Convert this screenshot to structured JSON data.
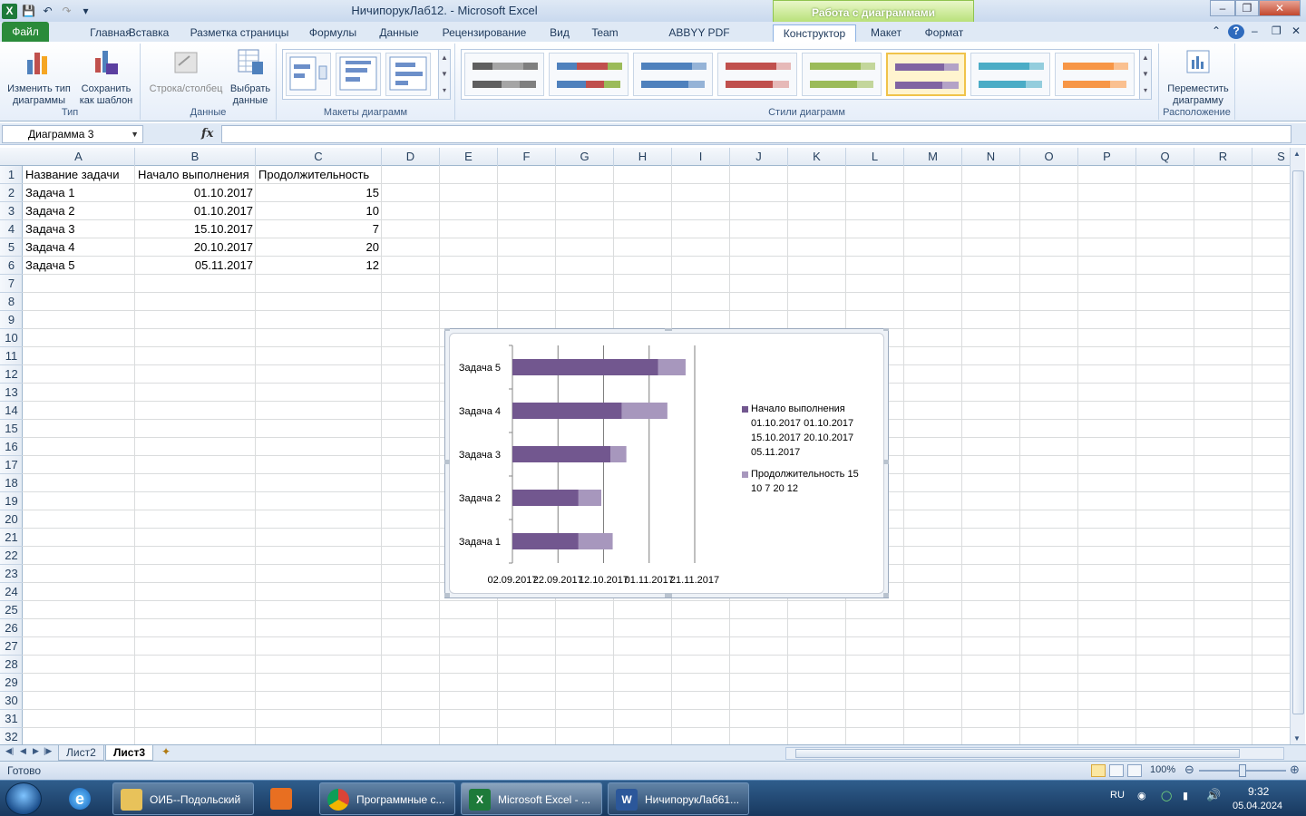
{
  "window": {
    "title": "НичипорукЛаб12.  -  Microsoft Excel",
    "context_tab_group": "Работа с диаграммами"
  },
  "tabs": {
    "file": "Файл",
    "items": [
      "Главная",
      "Вставка",
      "Разметка страницы",
      "Формулы",
      "Данные",
      "Рецензирование",
      "Вид",
      "Team",
      "ABBYY PDF Transformer+",
      "Конструктор",
      "Макет",
      "Формат"
    ],
    "active": "Конструктор"
  },
  "ribbon": {
    "group_type": {
      "label": "Тип",
      "change_type_1": "Изменить тип",
      "change_type_2": "диаграммы",
      "save_template_1": "Сохранить",
      "save_template_2": "как шаблон"
    },
    "group_data": {
      "label": "Данные",
      "row_col": "Строка/столбец",
      "select_data_1": "Выбрать",
      "select_data_2": "данные"
    },
    "group_layouts": {
      "label": "Макеты диаграмм"
    },
    "group_styles": {
      "label": "Стили диаграмм",
      "palettes": [
        [
          "#5f5f5f",
          "#a5a5a5",
          "#7f7f7f"
        ],
        [
          "#4f81bd",
          "#c0504d",
          "#9bbb59"
        ],
        [
          "#4f81bd",
          "#4f81bd",
          "#95b3d7"
        ],
        [
          "#c0504d",
          "#c0504d",
          "#e6b9b8"
        ],
        [
          "#9bbb59",
          "#9bbb59",
          "#c3d69b"
        ],
        [
          "#8064a2",
          "#8064a2",
          "#b3a2c7"
        ],
        [
          "#4bacc6",
          "#4bacc6",
          "#93cddd"
        ],
        [
          "#f79646",
          "#f79646",
          "#fac090"
        ]
      ],
      "selected_index": 5
    },
    "group_location": {
      "label": "Расположение",
      "move_1": "Переместить",
      "move_2": "диаграмму"
    }
  },
  "formula_bar": {
    "name_box": "Диаграмма 3",
    "fx": "fx",
    "formula": ""
  },
  "grid": {
    "columns": [
      "A",
      "B",
      "C",
      "D",
      "E",
      "F",
      "G",
      "H",
      "I",
      "J",
      "K",
      "L",
      "M",
      "N",
      "O",
      "P",
      "Q",
      "R",
      "S"
    ],
    "rows": [
      "1",
      "2",
      "3",
      "4",
      "5",
      "6",
      "7",
      "8",
      "9",
      "10",
      "11",
      "12",
      "13",
      "14",
      "15",
      "16",
      "17",
      "18",
      "19",
      "20",
      "21",
      "22",
      "23",
      "24",
      "25",
      "26",
      "27",
      "28",
      "29",
      "30",
      "31",
      "32"
    ],
    "header": [
      "Название задачи",
      "Начало выполнения",
      "Продолжительность"
    ],
    "data": [
      [
        "Задача 1",
        "01.10.2017",
        "15"
      ],
      [
        "Задача 2",
        "01.10.2017",
        "10"
      ],
      [
        "Задача 3",
        "15.10.2017",
        "7"
      ],
      [
        "Задача 4",
        "20.10.2017",
        "20"
      ],
      [
        "Задача 5",
        "05.11.2017",
        "12"
      ]
    ]
  },
  "chart_data": {
    "type": "bar",
    "orientation": "horizontal-stacked",
    "categories": [
      "Задача 1",
      "Задача 2",
      "Задача 3",
      "Задача 4",
      "Задача 5"
    ],
    "series": [
      {
        "name": "Начало выполнения 01.10.2017 01.10.2017 15.10.2017 20.10.2017 05.11.2017",
        "values": [
          "01.10.2017",
          "01.10.2017",
          "15.10.2017",
          "20.10.2017",
          "05.11.2017"
        ],
        "color": "#72578f"
      },
      {
        "name": "Продолжительность  15 10 7 20 12",
        "values": [
          15,
          10,
          7,
          20,
          12
        ],
        "color": "#a797bd"
      }
    ],
    "x_ticks": [
      "02.09.2017",
      "22.09.2017",
      "12.10.2017",
      "01.11.2017",
      "21.11.2017"
    ],
    "xlim": [
      "02.09.2017",
      "21.11.2017"
    ],
    "legend_position": "right",
    "grid": true,
    "legend": [
      [
        "Начало выполнения",
        "01.10.2017 01.10.2017",
        "15.10.2017 20.10.2017",
        "05.11.2017"
      ],
      [
        "Продолжительность  15",
        "10 7 20 12"
      ]
    ]
  },
  "sheets": {
    "tabs": [
      "Лист2",
      "Лист3"
    ],
    "active": "Лист3"
  },
  "status": {
    "ready": "Готово",
    "zoom": "100%"
  },
  "taskbar": {
    "items": [
      "ОИБ--Подольский",
      "Программные с...",
      "Microsoft Excel - ...",
      "НичипорукЛаб61..."
    ],
    "lang": "RU",
    "time": "9:32",
    "date": "05.04.2024"
  }
}
